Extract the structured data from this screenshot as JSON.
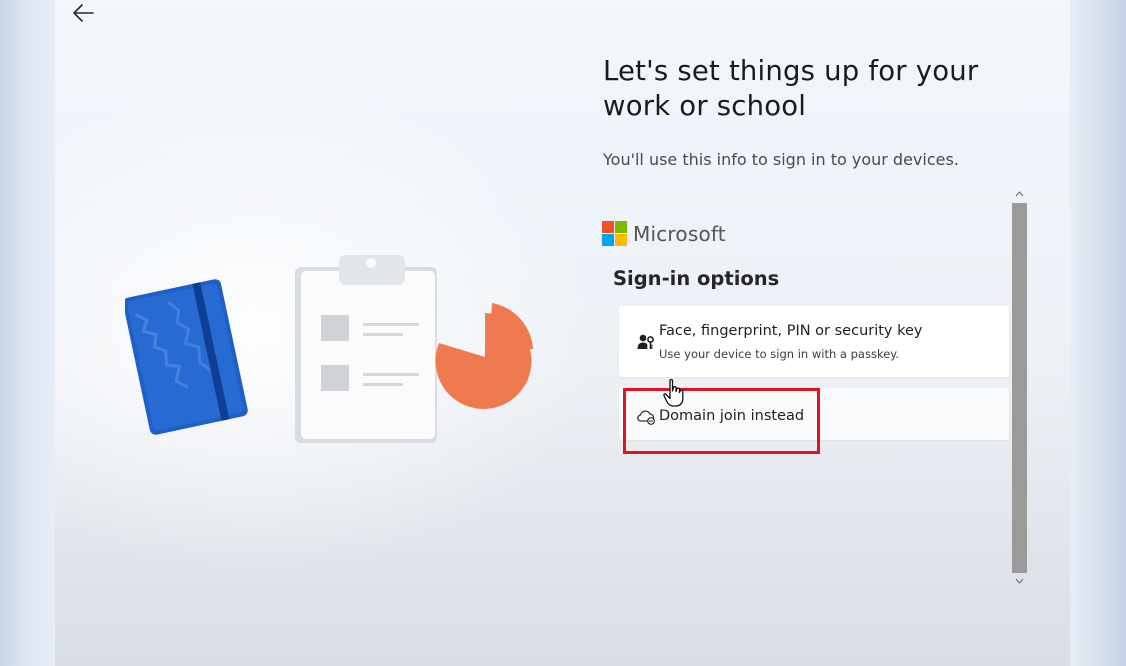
{
  "header": {
    "back_button": "back-arrow-icon",
    "title": "Let's set things up for your work or school",
    "subtitle": "You'll use this info to sign in to your devices."
  },
  "brand": {
    "name": "Microsoft",
    "logo_colors": [
      "#f25022",
      "#7fba00",
      "#00a4ef",
      "#ffb900"
    ]
  },
  "signin": {
    "heading": "Sign-in options",
    "options": [
      {
        "title": "Face, fingerprint, PIN or security key",
        "description": "Use your device to sign in with a passkey.",
        "icon": "person-key-icon"
      },
      {
        "title": "Domain join instead",
        "icon": "cloud-domain-icon"
      }
    ]
  },
  "annotation": {
    "highlight_color": "#e0141e"
  },
  "scrollbar": {
    "up_icon": "chevron-up-icon",
    "down_icon": "chevron-down-icon"
  },
  "illustration": {
    "items": [
      "notebook",
      "clipboard",
      "pie-chart"
    ],
    "colors": {
      "notebook": "#1f5fc7",
      "pie": "#f07a4f",
      "clipboard": "#ffffff"
    }
  }
}
